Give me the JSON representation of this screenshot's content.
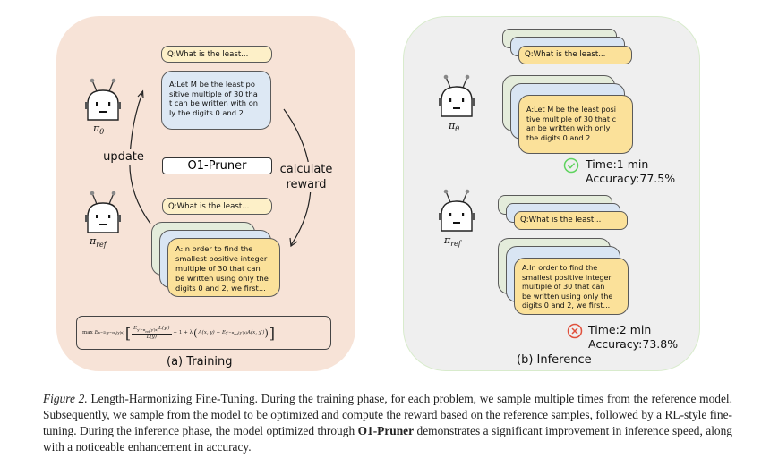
{
  "figure": {
    "training_panel": {
      "subcaption": "(a) Training",
      "question_label": "Q:What is the least...",
      "policy_answer": "A:Let M be the least po\nsitive multiple of 30 tha\nt can be written with on\nly the digits 0 and 2...",
      "method_label": "O1-Pruner",
      "update_label": "update",
      "reward_label_line1": "calculate",
      "reward_label_line2": "reward",
      "question_label_2": "Q:What is the least...",
      "ref_answer": "A:In order to find the\nsmallest positive integer\nmultiple of 30 that can\nbe written using only the\ndigits 0 and 2, we first...",
      "policy_symbol": "π",
      "policy_subscript": "θ",
      "ref_symbol": "π",
      "ref_subscript": "ref",
      "formula": "max E_{x~D, y~π_θ(y|x)} [ E_{y'~π_ref(y'|x)} L(y') / L(y) − 1 + λ ( A(x,y) − E_{y'~π_ref(y'|x)} A(x,y') ) ]",
      "formula_parts": {
        "max": "max",
        "outer_exp": "E",
        "outer_sub": "x∼D,y∼π",
        "outer_sub_theta": "θ",
        "outer_cond": "(y|x)",
        "num_exp": "E",
        "num_sub": "y′∼π",
        "num_sub_ref": "ref",
        "num_cond": "(y′|x)",
        "num_term": "L(y′)",
        "den": "L(y)",
        "rest": "− 1 + λ",
        "adv": "A(x, y) − E",
        "adv_sub": "y′∼π",
        "adv_sub_ref": "ref",
        "adv_cond": "(y′|x)",
        "adv_end": "A(x, y′)"
      }
    },
    "inference_panel": {
      "subcaption": "(b) Inference",
      "top": {
        "question_label": "Q:What is the least...",
        "answer": "A:Let M be the least posi\ntive multiple of 30 that c\nan be written with only\nthe digits 0 and 2...",
        "policy_symbol": "π",
        "policy_subscript": "θ",
        "status_icon": "check-circle-icon",
        "status_color": "#5fd35f",
        "time": "Time:1 min",
        "accuracy": "Accuracy:77.5%"
      },
      "bottom": {
        "question_label": "Q:What is the least...",
        "answer": "A:In order to find the\nsmallest positive integer\nmultiple of 30 that can\nbe written using only the\ndigits 0 and 2, we first...",
        "policy_symbol": "π",
        "policy_subscript": "ref",
        "status_icon": "x-circle-icon",
        "status_color": "#e0503c",
        "time": "Time:2 min",
        "accuracy": "Accuracy:73.8%"
      }
    },
    "colors": {
      "training_bg": "#f7e3d7",
      "inference_bg": "#efefef",
      "card_yellow": "#fbe19a",
      "card_blue": "#dde8f4",
      "card_green": "#e4ecdb",
      "question_card": "#fdf0c8"
    }
  },
  "caption": {
    "label": "Figure 2.",
    "text_1": " Length-Harmonizing Fine-Tuning. During the training phase, for each problem, we sample multiple times from the reference model. Subsequently, we sample from the model to be optimized and compute the reward based on the reference samples, followed by a RL-style fine-tuning. During the inference phase, the model optimized through ",
    "bold": "O1-Pruner",
    "text_2": " demonstrates a significant improvement in inference speed, along with a noticeable enhancement in accuracy."
  }
}
